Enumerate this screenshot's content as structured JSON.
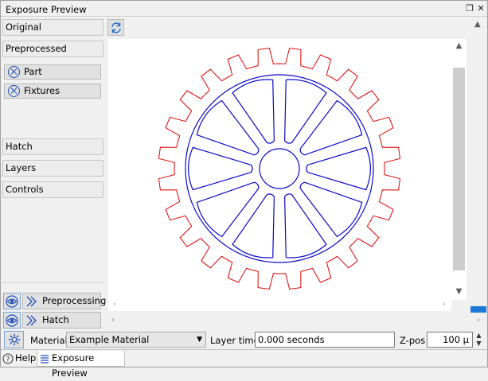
{
  "window": {
    "title": "Exposure Preview"
  },
  "left_panel": {
    "sections": [
      "Original",
      "Preprocessed",
      "Hatch",
      "Layers",
      "Controls"
    ],
    "sub_items": [
      "Part",
      "Fixtures"
    ],
    "actions": [
      "Preprocessing",
      "Hatch"
    ]
  },
  "bottom": {
    "material_label": "Material",
    "material_value": "Example Material",
    "layer_time_label": "Layer time",
    "layer_time_value": "0.000 seconds",
    "zpos_label": "Z-pos",
    "zpos_value": "100 μ"
  },
  "tabs": [
    "Help",
    "Exposure Preview"
  ],
  "colors": {
    "gear_outer": "#e00000",
    "gear_inner": "#0a0ac8",
    "accent": "#1c7ad6"
  },
  "icons": [
    "restore-icon",
    "close-icon",
    "refresh-icon",
    "circle-x-icon",
    "eye-icon",
    "layers-arrow-icon",
    "gear-settings-icon",
    "help-icon",
    "list-icon"
  ]
}
